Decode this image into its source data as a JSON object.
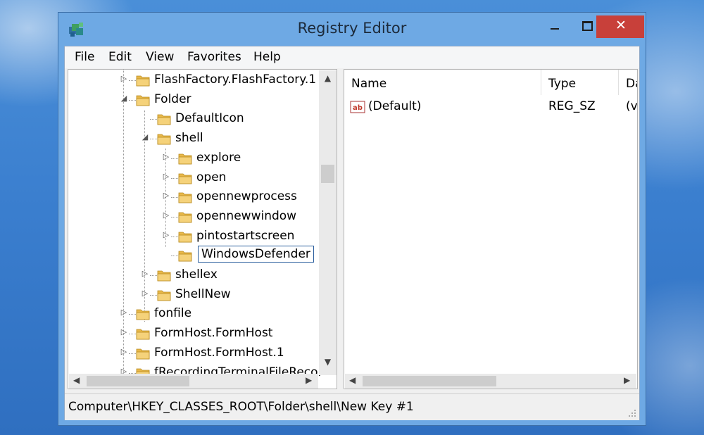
{
  "window": {
    "title": "Registry Editor",
    "close_glyph": "✕"
  },
  "menu": [
    "File",
    "Edit",
    "View",
    "Favorites",
    "Help"
  ],
  "tree": {
    "items": [
      {
        "label": "FlashFactory.FlashFactory.1",
        "expander": "▷",
        "level": 0
      },
      {
        "label": "Folder",
        "expander": "◢",
        "level": 0
      },
      {
        "label": "DefaultIcon",
        "expander": "",
        "level": 1
      },
      {
        "label": "shell",
        "expander": "◢",
        "level": 1
      },
      {
        "label": "explore",
        "expander": "▷",
        "level": 2
      },
      {
        "label": "open",
        "expander": "▷",
        "level": 2
      },
      {
        "label": "opennewprocess",
        "expander": "▷",
        "level": 2
      },
      {
        "label": "opennewwindow",
        "expander": "▷",
        "level": 2
      },
      {
        "label": "pintostartscreen",
        "expander": "▷",
        "level": 2
      },
      {
        "label": "WindowsDefender",
        "expander": "",
        "level": 2,
        "editing": true
      },
      {
        "label": "shellex",
        "expander": "▷",
        "level": 1
      },
      {
        "label": "ShellNew",
        "expander": "▷",
        "level": 1
      },
      {
        "label": "fonfile",
        "expander": "▷",
        "level": 0
      },
      {
        "label": "FormHost.FormHost",
        "expander": "▷",
        "level": 0
      },
      {
        "label": "FormHost.FormHost.1",
        "expander": "▷",
        "level": 0
      },
      {
        "label": "fRecordingTerminalFileRecor",
        "expander": "▷",
        "level": 0
      }
    ],
    "scroll_up": "▲",
    "scroll_down": "▼",
    "scroll_left": "◀",
    "scroll_right": "▶"
  },
  "list": {
    "columns": [
      "Name",
      "Type",
      "Da"
    ],
    "rows": [
      {
        "icon": "ab",
        "name": "(Default)",
        "type": "REG_SZ",
        "data": "(va"
      }
    ],
    "scroll_left": "◀",
    "scroll_right": "▶"
  },
  "status": {
    "path": "Computer\\HKEY_CLASSES_ROOT\\Folder\\shell\\New Key #1"
  },
  "colors": {
    "accent": "#3b7fcf",
    "close_button": "#c8403a",
    "folder": "#e8b84a"
  }
}
